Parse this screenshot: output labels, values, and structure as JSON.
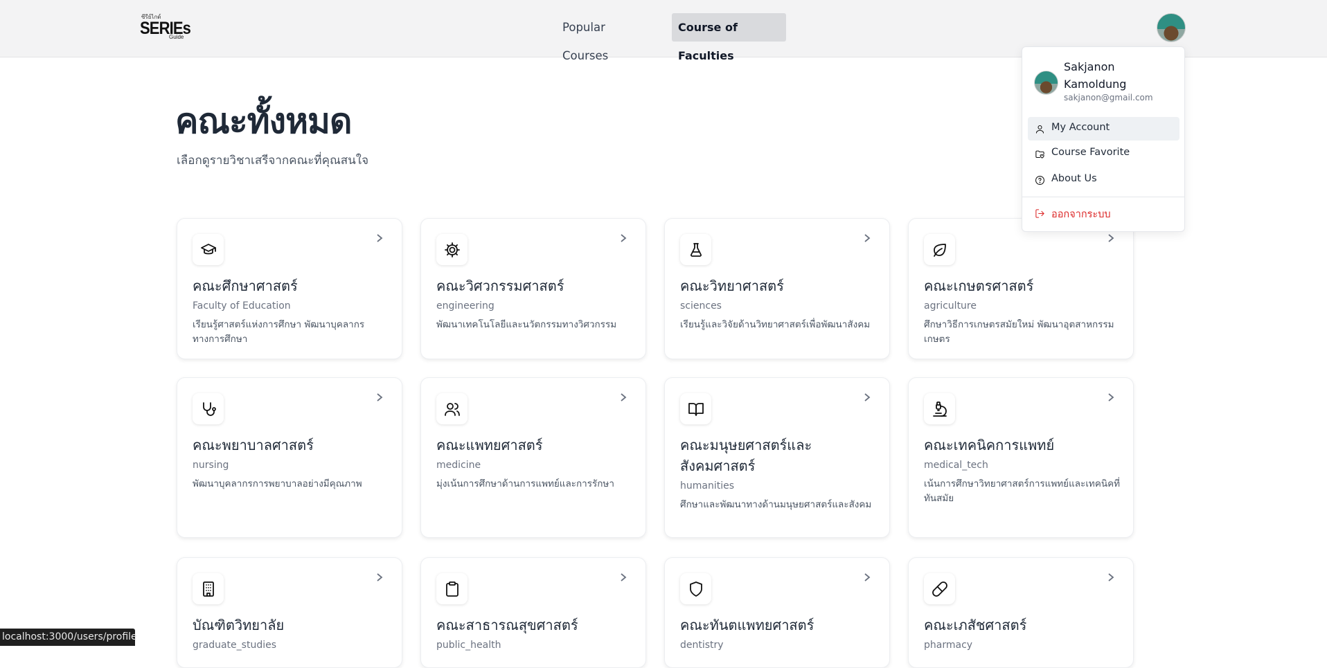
{
  "header": {
    "logo_small": "ซีรีย์ไกด์",
    "logo_main": "SERIEs",
    "logo_sub": "Guide",
    "nav": [
      {
        "label": "Popular Courses",
        "active": false
      },
      {
        "label": "Course of Faculties",
        "active": true
      }
    ]
  },
  "main": {
    "title": "คณะทั้งหมด",
    "subtitle": "เลือกดูรายวิชาเสรีจากคณะที่คุณสนใจ",
    "faculties": [
      {
        "icon": "graduation-cap-icon",
        "name": "คณะศึกษาศาสตร์",
        "en": "Faculty of Education",
        "desc": "เรียนรู้ศาสตร์แห่งการศึกษา พัฒนาบุคลากรทางการศึกษา"
      },
      {
        "icon": "gear-icon",
        "name": "คณะวิศวกรรมศาสตร์",
        "en": "engineering",
        "desc": "พัฒนาเทคโนโลยีและนวัตกรรมทางวิศวกรรม"
      },
      {
        "icon": "flask-icon",
        "name": "คณะวิทยาศาสตร์",
        "en": "sciences",
        "desc": "เรียนรู้และวิจัยด้านวิทยาศาสตร์เพื่อพัฒนาสังคม"
      },
      {
        "icon": "leaf-icon",
        "name": "คณะเกษตรศาสตร์",
        "en": "agriculture",
        "desc": "ศึกษาวิธีการเกษตรสมัยใหม่ พัฒนาอุตสาหกรรมเกษตร"
      },
      {
        "icon": "stethoscope-icon",
        "name": "คณะพยาบาลศาสตร์",
        "en": "nursing",
        "desc": "พัฒนาบุคลากรการพยาบาลอย่างมีคุณภาพ"
      },
      {
        "icon": "users-icon",
        "name": "คณะแพทยศาสตร์",
        "en": "medicine",
        "desc": "มุ่งเน้นการศึกษาด้านการแพทย์และการรักษา"
      },
      {
        "icon": "book-open-icon",
        "name": "คณะมนุษยศาสตร์และสังคมศาสตร์",
        "en": "humanities",
        "desc": "ศึกษาและพัฒนาทางด้านมนุษยศาสตร์และสังคม"
      },
      {
        "icon": "microscope-icon",
        "name": "คณะเทคนิคการแพทย์",
        "en": "medical_tech",
        "desc": "เน้นการศึกษาวิทยาศาสตร์การแพทย์และเทคนิคที่ทันสมัย"
      },
      {
        "icon": "building-icon",
        "name": "บัณฑิตวิทยาลัย",
        "en": "graduate_studies",
        "desc": ""
      },
      {
        "icon": "clipboard-icon",
        "name": "คณะสาธารณสุขศาสตร์",
        "en": "public_health",
        "desc": ""
      },
      {
        "icon": "shield-icon",
        "name": "คณะทันตแพทยศาสตร์",
        "en": "dentistry",
        "desc": ""
      },
      {
        "icon": "pill-icon",
        "name": "คณะเภสัชศาสตร์",
        "en": "pharmacy",
        "desc": ""
      }
    ]
  },
  "user_menu": {
    "name": "Sakjanon Kamoldung",
    "email": "sakjanon@gmail.com",
    "items": [
      {
        "icon": "user-icon",
        "label": "My Account"
      },
      {
        "icon": "folder-heart-icon",
        "label": "Course Favorite"
      },
      {
        "icon": "help-circle-icon",
        "label": "About Us"
      }
    ],
    "logout_label": "ออกจากระบบ",
    "logout_color": "#dc2626"
  },
  "status_url": "localhost:3000/users/profile"
}
